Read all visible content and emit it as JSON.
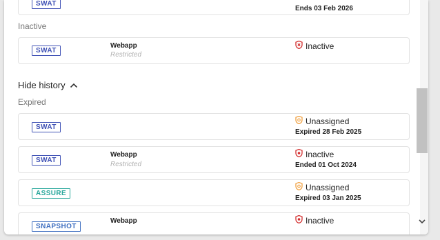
{
  "top_card": {
    "tag": "SWAT",
    "status_date": "Ends 03 Feb 2026"
  },
  "inactive_section": {
    "label": "Inactive",
    "card": {
      "tag": "SWAT",
      "app": "Webapp",
      "app_sub": "Restricted",
      "status": "Inactive",
      "status_icon": "shield-icon"
    }
  },
  "history_toggle": {
    "label": "Hide history",
    "icon": "chevron-up-icon"
  },
  "expired_section": {
    "label": "Expired",
    "cards": [
      {
        "tag": "SWAT",
        "app": "",
        "app_sub": "",
        "status": "Unassigned",
        "status_icon": "unassigned-shield-icon",
        "date": "Expired 28 Feb 2025"
      },
      {
        "tag": "SWAT",
        "app": "Webapp",
        "app_sub": "Restricted",
        "status": "Inactive",
        "status_icon": "shield-icon",
        "date": "Ended 01 Oct 2024"
      },
      {
        "tag": "ASSURE",
        "app": "",
        "app_sub": "",
        "status": "Unassigned",
        "status_icon": "unassigned-shield-icon",
        "date": "Expired 03 Jan 2025"
      },
      {
        "tag": "SNAPSHOT",
        "app": "Webapp",
        "app_sub": "",
        "status": "Inactive",
        "status_icon": "shield-icon",
        "date": ""
      }
    ]
  },
  "colors": {
    "swat": "#3f51b5",
    "assure": "#26a69a",
    "snapshot": "#3f6fc0",
    "inactive_icon": "#d32f2f",
    "unassigned_icon": "#f0a040"
  }
}
